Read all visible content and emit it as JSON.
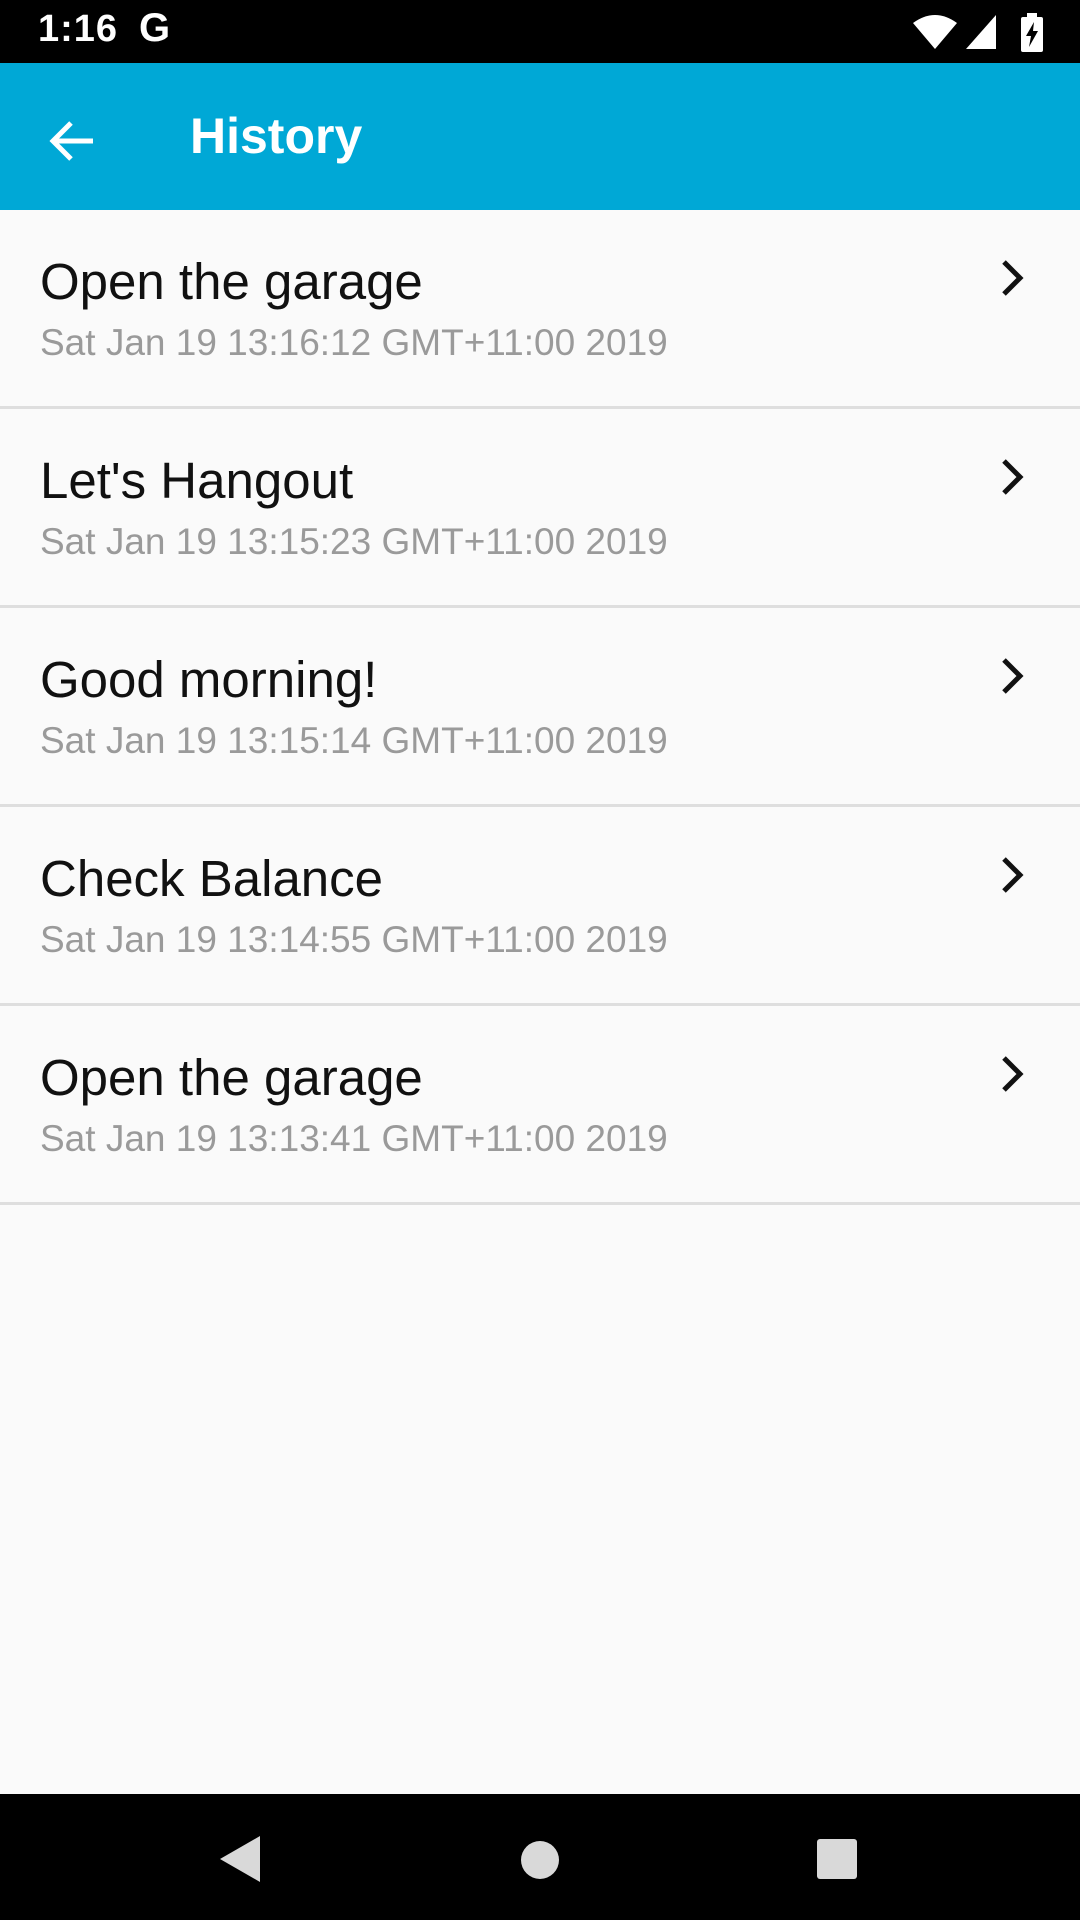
{
  "status_bar": {
    "time": "1:16",
    "google_letter": "G"
  },
  "app_bar": {
    "title": "History",
    "background_color": "#00a8d6"
  },
  "history": [
    {
      "title": "Open the garage",
      "timestamp": "Sat Jan 19 13:16:12 GMT+11:00 2019"
    },
    {
      "title": "Let's Hangout",
      "timestamp": "Sat Jan 19 13:15:23 GMT+11:00 2019"
    },
    {
      "title": "Good morning!",
      "timestamp": "Sat Jan 19 13:15:14 GMT+11:00 2019"
    },
    {
      "title": "Check Balance",
      "timestamp": "Sat Jan 19 13:14:55 GMT+11:00 2019"
    },
    {
      "title": "Open the garage",
      "timestamp": "Sat Jan 19 13:13:41 GMT+11:00 2019"
    }
  ],
  "icons": {
    "back": "arrow-left-icon",
    "chevron": "chevron-right-icon",
    "wifi": "wifi-icon",
    "signal": "cell-signal-icon",
    "battery": "battery-charging-icon",
    "nav_back": "nav-back-icon",
    "nav_home": "nav-home-icon",
    "nav_recents": "nav-recents-icon"
  }
}
